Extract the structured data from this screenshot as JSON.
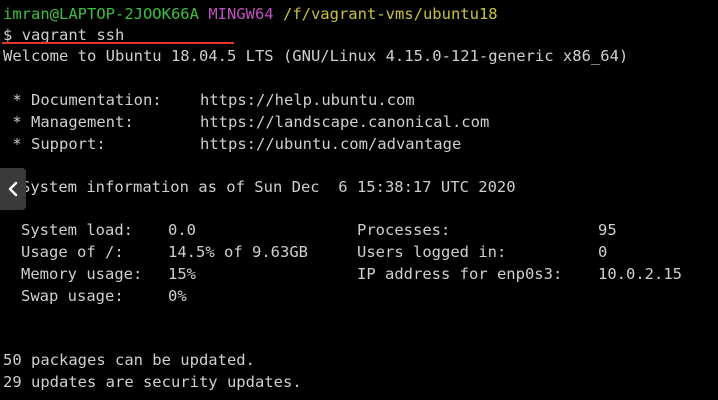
{
  "prompt": {
    "user_host": "imran@LAPTOP-2JOOK66A",
    "shell": "MINGW64",
    "path": "/f/vagrant-vms/ubuntu18"
  },
  "command": {
    "symbol": "$",
    "text": "vagrant ssh"
  },
  "welcome": "Welcome to Ubuntu 18.04.5 LTS (GNU/Linux 4.15.0-121-generic x86_64)",
  "links": [
    {
      "label": " * Documentation:",
      "url": "https://help.ubuntu.com"
    },
    {
      "label": " * Management:",
      "url": "https://landscape.canonical.com"
    },
    {
      "label": " * Support:",
      "url": "https://ubuntu.com/advantage"
    }
  ],
  "sysinfo_header": "System information as of Sun Dec  6 15:38:17 UTC 2020",
  "stats_left": [
    {
      "label": "System load:",
      "value": "0.0"
    },
    {
      "label": "Usage of /:",
      "value": "14.5% of 9.63GB"
    },
    {
      "label": "Memory usage:",
      "value": "15%"
    },
    {
      "label": "Swap usage:",
      "value": "0%"
    }
  ],
  "stats_right": [
    {
      "label": "Processes:",
      "value": "95"
    },
    {
      "label": "Users logged in:",
      "value": "0"
    },
    {
      "label": "IP address for enp0s3:",
      "value": "10.0.2.15"
    }
  ],
  "updates": [
    "50 packages can be updated.",
    "29 updates are security updates."
  ],
  "colors": {
    "background": "#000000",
    "text": "#cfcfcf",
    "prompt_user": "#3fbf3f",
    "prompt_shell": "#c050c0",
    "prompt_path": "#c9c241",
    "underline": "#e2362f"
  },
  "icons": {
    "prev": "chevron-left-icon"
  }
}
